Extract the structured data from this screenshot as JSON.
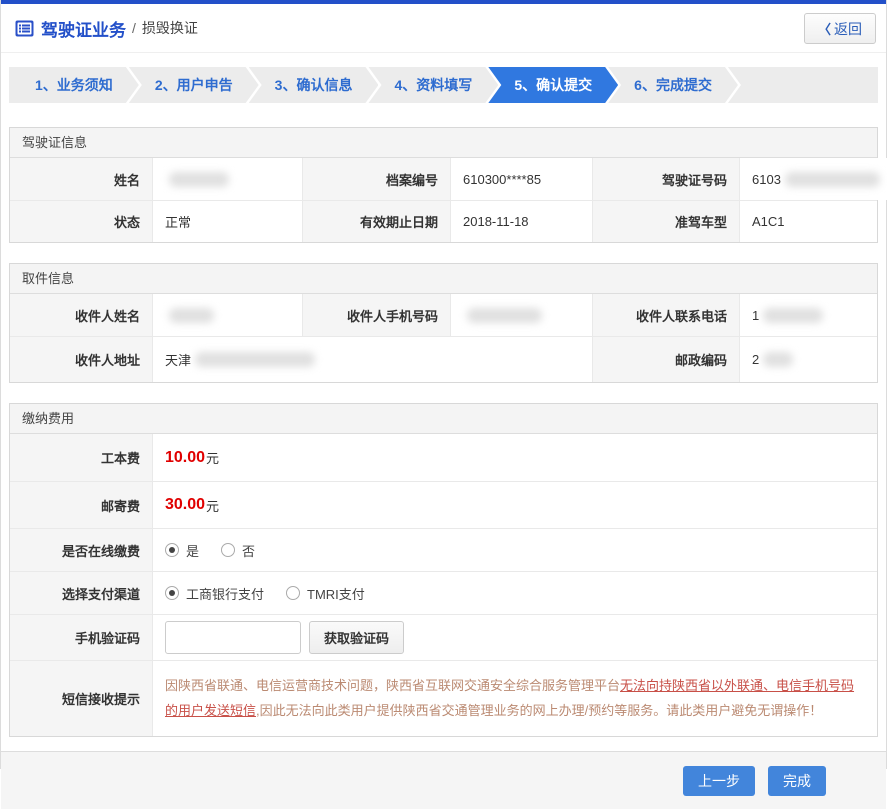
{
  "colors": {
    "accent-dark": "#2350c9",
    "step-blue": "#2e6cd0",
    "step-active": "#3078e0",
    "btn-blue": "#4285db",
    "fee-red": "#e00000",
    "notice-base": "#bb8a72",
    "notice-strong": "#c85048"
  },
  "header": {
    "title": "驾驶证业务",
    "separator": "/",
    "subtitle": "损毁换证",
    "back_chevron": "〈",
    "back_label": "返回"
  },
  "steps": {
    "items": [
      {
        "label": "1、业务须知"
      },
      {
        "label": "2、用户申告"
      },
      {
        "label": "3、确认信息"
      },
      {
        "label": "4、资料填写"
      },
      {
        "label": "5、确认提交"
      },
      {
        "label": "6、完成提交"
      }
    ],
    "active_label": "5、确认提交"
  },
  "license": {
    "title": "驾驶证信息",
    "name_label": "姓名",
    "file_no_label": "档案编号",
    "file_no_value": "610300****85",
    "license_no_label": "驾驶证号码",
    "license_no_prefix": "6103",
    "status_label": "状态",
    "status_value": "正常",
    "expiry_label": "有效期止日期",
    "expiry_value": "2018-11-18",
    "vehicle_label": "准驾车型",
    "vehicle_value": "A1C1"
  },
  "pickup": {
    "title": "取件信息",
    "recipient_name_label": "收件人姓名",
    "mobile_label": "收件人手机号码",
    "phone_label": "收件人联系电话",
    "phone_prefix": "1",
    "address_label": "收件人地址",
    "address_prefix": "天津",
    "postal_label": "邮政编码",
    "postal_prefix": "2"
  },
  "payment": {
    "title": "缴纳费用",
    "fee1_label": "工本费",
    "fee1_value": "10.00",
    "fee2_label": "邮寄费",
    "fee2_value": "30.00",
    "fee_unit": "元",
    "online_label": "是否在线缴费",
    "online_yes": "是",
    "online_no": "否",
    "channel_label": "选择支付渠道",
    "channel1": "工商银行支付",
    "channel2": "TMRI支付",
    "code_label": "手机验证码",
    "code_button": "获取验证码",
    "notice_label": "短信接收提示",
    "notice_part1": "因陕西省联通、电信运营商技术问题，陕西省互联网交通安全综合服务管理平台",
    "notice_part2": "无法向持陕西省以外联通、电信手机号码的用户发送短信",
    "notice_part3": ",因此无法向此类用户提供陕西省交通管理业务的网上办理/预约等服务。请此类用户避免无谓操作！"
  },
  "footer": {
    "prev_label": "上一步",
    "finish_label": "完成"
  }
}
